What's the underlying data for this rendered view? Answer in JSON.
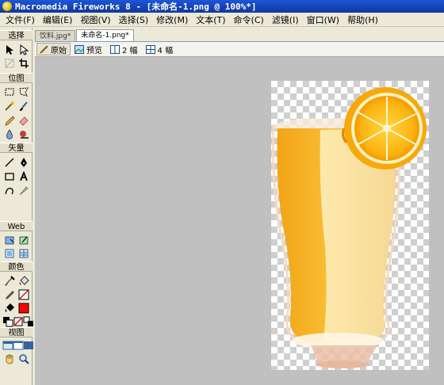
{
  "window": {
    "title": "Macromedia Fireworks 8 - [未命名-1.png @ 100%*]"
  },
  "menu": [
    "文件(F)",
    "编辑(E)",
    "视图(V)",
    "选择(S)",
    "修改(M)",
    "文本(T)",
    "命令(C)",
    "滤镜(I)",
    "窗口(W)",
    "帮助(H)"
  ],
  "tools": {
    "sections": {
      "select": "选择",
      "bitmap": "位图",
      "vector": "矢量",
      "web": "Web",
      "colors": "颜色",
      "view": "视图"
    },
    "stroke_color": "#000000",
    "fill_color": "#ff0000"
  },
  "documents": {
    "tabs": [
      "饮料.jpg*",
      "未命名-1.png*"
    ],
    "active_tab": 1
  },
  "view_bar": {
    "original": "原始",
    "preview": "预览",
    "two_up": "2 幅",
    "four_up": "4 幅"
  }
}
